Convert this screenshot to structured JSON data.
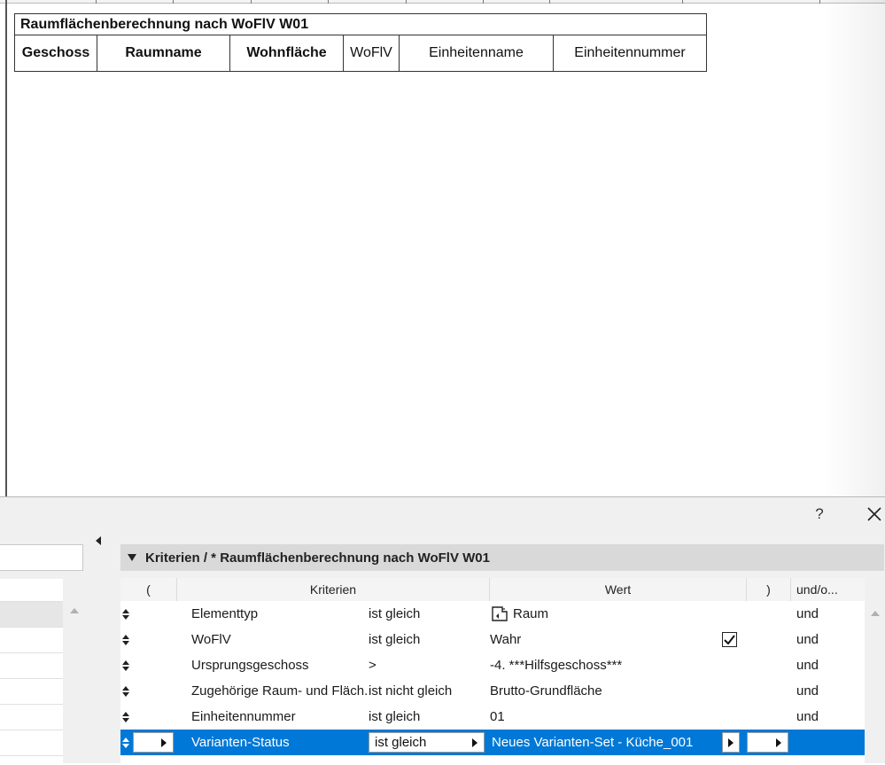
{
  "report_table": {
    "title": "Raumflächenberechnung nach WoFlV W01",
    "columns": [
      "Geschoss",
      "Raumname",
      "Wohnfläche",
      "WoFlV",
      "Einheitenname",
      "Einheitennummer"
    ]
  },
  "dialog": {
    "help_label": "?",
    "criteria_title": "Kriterien / * Raumflächenberechnung nach WoFlV W01",
    "grid_headers": {
      "open_paren": "(",
      "criteria": "Kriterien",
      "value": "Wert",
      "close_paren": ")",
      "and_or": "und/o..."
    },
    "rows": [
      {
        "criterion": "Elementtyp",
        "operator": "ist gleich",
        "value": "Raum",
        "icon": "room-icon",
        "logic": "und"
      },
      {
        "criterion": "WoFlV",
        "operator": "ist gleich",
        "value": "Wahr",
        "checked": true,
        "logic": "und"
      },
      {
        "criterion": "Ursprungsgeschoss",
        "operator": ">",
        "value": "-4. ***Hilfsgeschoss***",
        "logic": "und"
      },
      {
        "criterion": "Zugehörige Raum- und Fläch...",
        "operator": "ist nicht gleich",
        "value": "Brutto-Grundfläche",
        "logic": "und"
      },
      {
        "criterion": "Einheitennummer",
        "operator": "ist gleich",
        "value": "01",
        "logic": "und"
      },
      {
        "criterion": "Varianten-Status",
        "operator": "ist gleich",
        "value": "Neues Varianten-Set - Küche_001",
        "logic": ""
      }
    ],
    "colors": {
      "selection": "#0078d7",
      "title_bar": "#d9d9d9",
      "panel_bg": "#f0f0f0"
    }
  }
}
